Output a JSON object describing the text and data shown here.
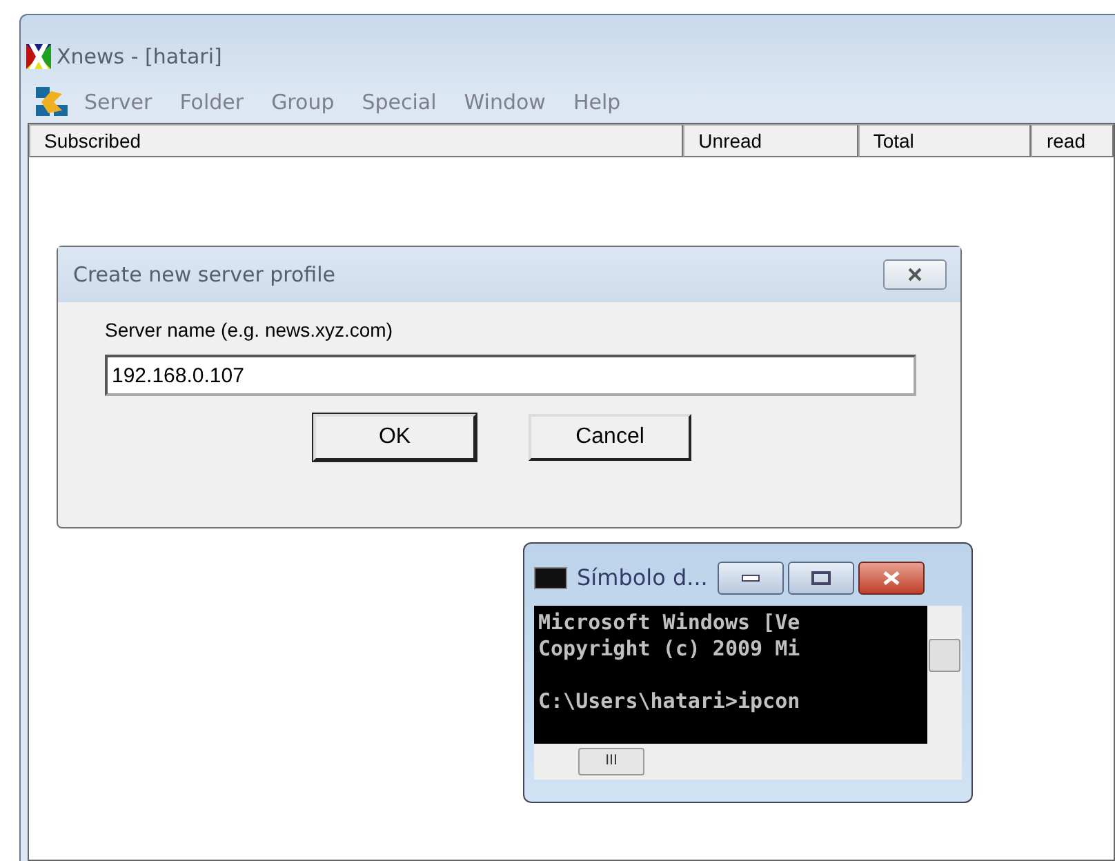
{
  "window": {
    "title": "Xnews - [hatari]"
  },
  "menu": [
    "Server",
    "Folder",
    "Group",
    "Special",
    "Window",
    "Help"
  ],
  "table": {
    "columns": [
      "Subscribed",
      "Unread",
      "Total",
      "read"
    ]
  },
  "dialog": {
    "title": "Create new server profile",
    "field_label": "Server name (e.g. news.xyz.com)",
    "field_value": "192.168.0.107",
    "buttons": [
      "OK",
      "Cancel"
    ]
  },
  "console": {
    "title": "Símbolo d...",
    "paragraphs": [
      [
        "Microsoft Windows [Ve",
        "Copyright (c) 2009 Mi"
      ],
      [
        "C:\\Users\\hatari>ipcon"
      ]
    ],
    "scroll_thumb": "III"
  }
}
